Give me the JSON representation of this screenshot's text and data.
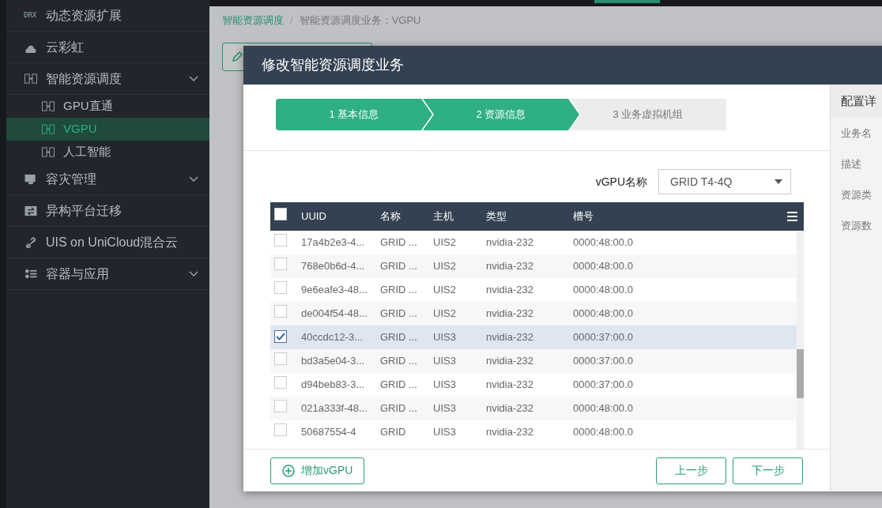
{
  "sidebar": {
    "items": [
      {
        "label": "动态资源扩展",
        "kind": "drx",
        "icon_text": "DRX",
        "selected": false
      },
      {
        "label": "云彩虹",
        "kind": "cloud",
        "selected": false
      },
      {
        "label": "智能资源调度",
        "kind": "gpu",
        "expandable": true,
        "selected": false,
        "children": [
          {
            "label": "GPU直通",
            "kind": "gpu",
            "selected": false
          },
          {
            "label": "VGPU",
            "kind": "gpu",
            "selected": true
          },
          {
            "label": "人工智能",
            "kind": "gpu",
            "selected": false
          }
        ]
      },
      {
        "label": "容灾管理",
        "kind": "disaster",
        "expandable": true,
        "selected": false
      },
      {
        "label": "异构平台迁移",
        "kind": "migrate",
        "selected": false
      },
      {
        "label": "UIS on UniCloud混合云",
        "kind": "link",
        "selected": false
      },
      {
        "label": "容器与应用",
        "kind": "apps",
        "expandable": true,
        "selected": false
      }
    ]
  },
  "breadcrumb": [
    "智能资源调度",
    "智能资源调度业务：VGPU"
  ],
  "breadcrumb_separator": "/",
  "modal": {
    "title": "修改智能资源调度业务",
    "steps": [
      {
        "label": "1 基本信息",
        "active": true
      },
      {
        "label": "2 资源信息",
        "active": true
      },
      {
        "label": "3 业务虚拟机组",
        "active": false
      }
    ],
    "filter": {
      "label": "vGPU名称",
      "value": "GRID T4-4Q"
    },
    "table": {
      "header_checked": false,
      "columns": [
        "UUID",
        "名称",
        "主机",
        "类型",
        "槽号"
      ],
      "rows": [
        {
          "checked": false,
          "cells": [
            "17a4b2e3-4...",
            "GRID ...",
            "UIS2",
            "nvidia-232",
            "0000:48:00.0"
          ]
        },
        {
          "checked": false,
          "cells": [
            "768e0b6d-4...",
            "GRID ...",
            "UIS2",
            "nvidia-232",
            "0000:48:00.0"
          ]
        },
        {
          "checked": false,
          "cells": [
            "9e6eafe3-48...",
            "GRID ...",
            "UIS2",
            "nvidia-232",
            "0000:48:00.0"
          ]
        },
        {
          "checked": false,
          "cells": [
            "de004f54-48...",
            "GRID ...",
            "UIS2",
            "nvidia-232",
            "0000:48:00.0"
          ]
        },
        {
          "checked": true,
          "cells": [
            "40ccdc12-3...",
            "GRID ...",
            "UIS3",
            "nvidia-232",
            "0000:37:00.0"
          ]
        },
        {
          "checked": false,
          "cells": [
            "bd3a5e04-3...",
            "GRID ...",
            "UIS3",
            "nvidia-232",
            "0000:37:00.0"
          ]
        },
        {
          "checked": false,
          "cells": [
            "d94beb83-3...",
            "GRID ...",
            "UIS3",
            "nvidia-232",
            "0000:37:00.0"
          ]
        },
        {
          "checked": false,
          "cells": [
            "021a333f-48...",
            "GRID ...",
            "UIS3",
            "nvidia-232",
            "0000:48:00.0"
          ]
        },
        {
          "checked": false,
          "cells": [
            "50687554-4",
            "GRID",
            "UIS3",
            "nvidia-232",
            "0000:48:00.0"
          ]
        }
      ]
    },
    "add_button": "增加vGPU",
    "nav_buttons": [
      "上一步",
      "下一步"
    ],
    "details": {
      "title": "配置详",
      "fields": [
        "业务名",
        "描述",
        "资源类",
        "资源数"
      ]
    }
  }
}
